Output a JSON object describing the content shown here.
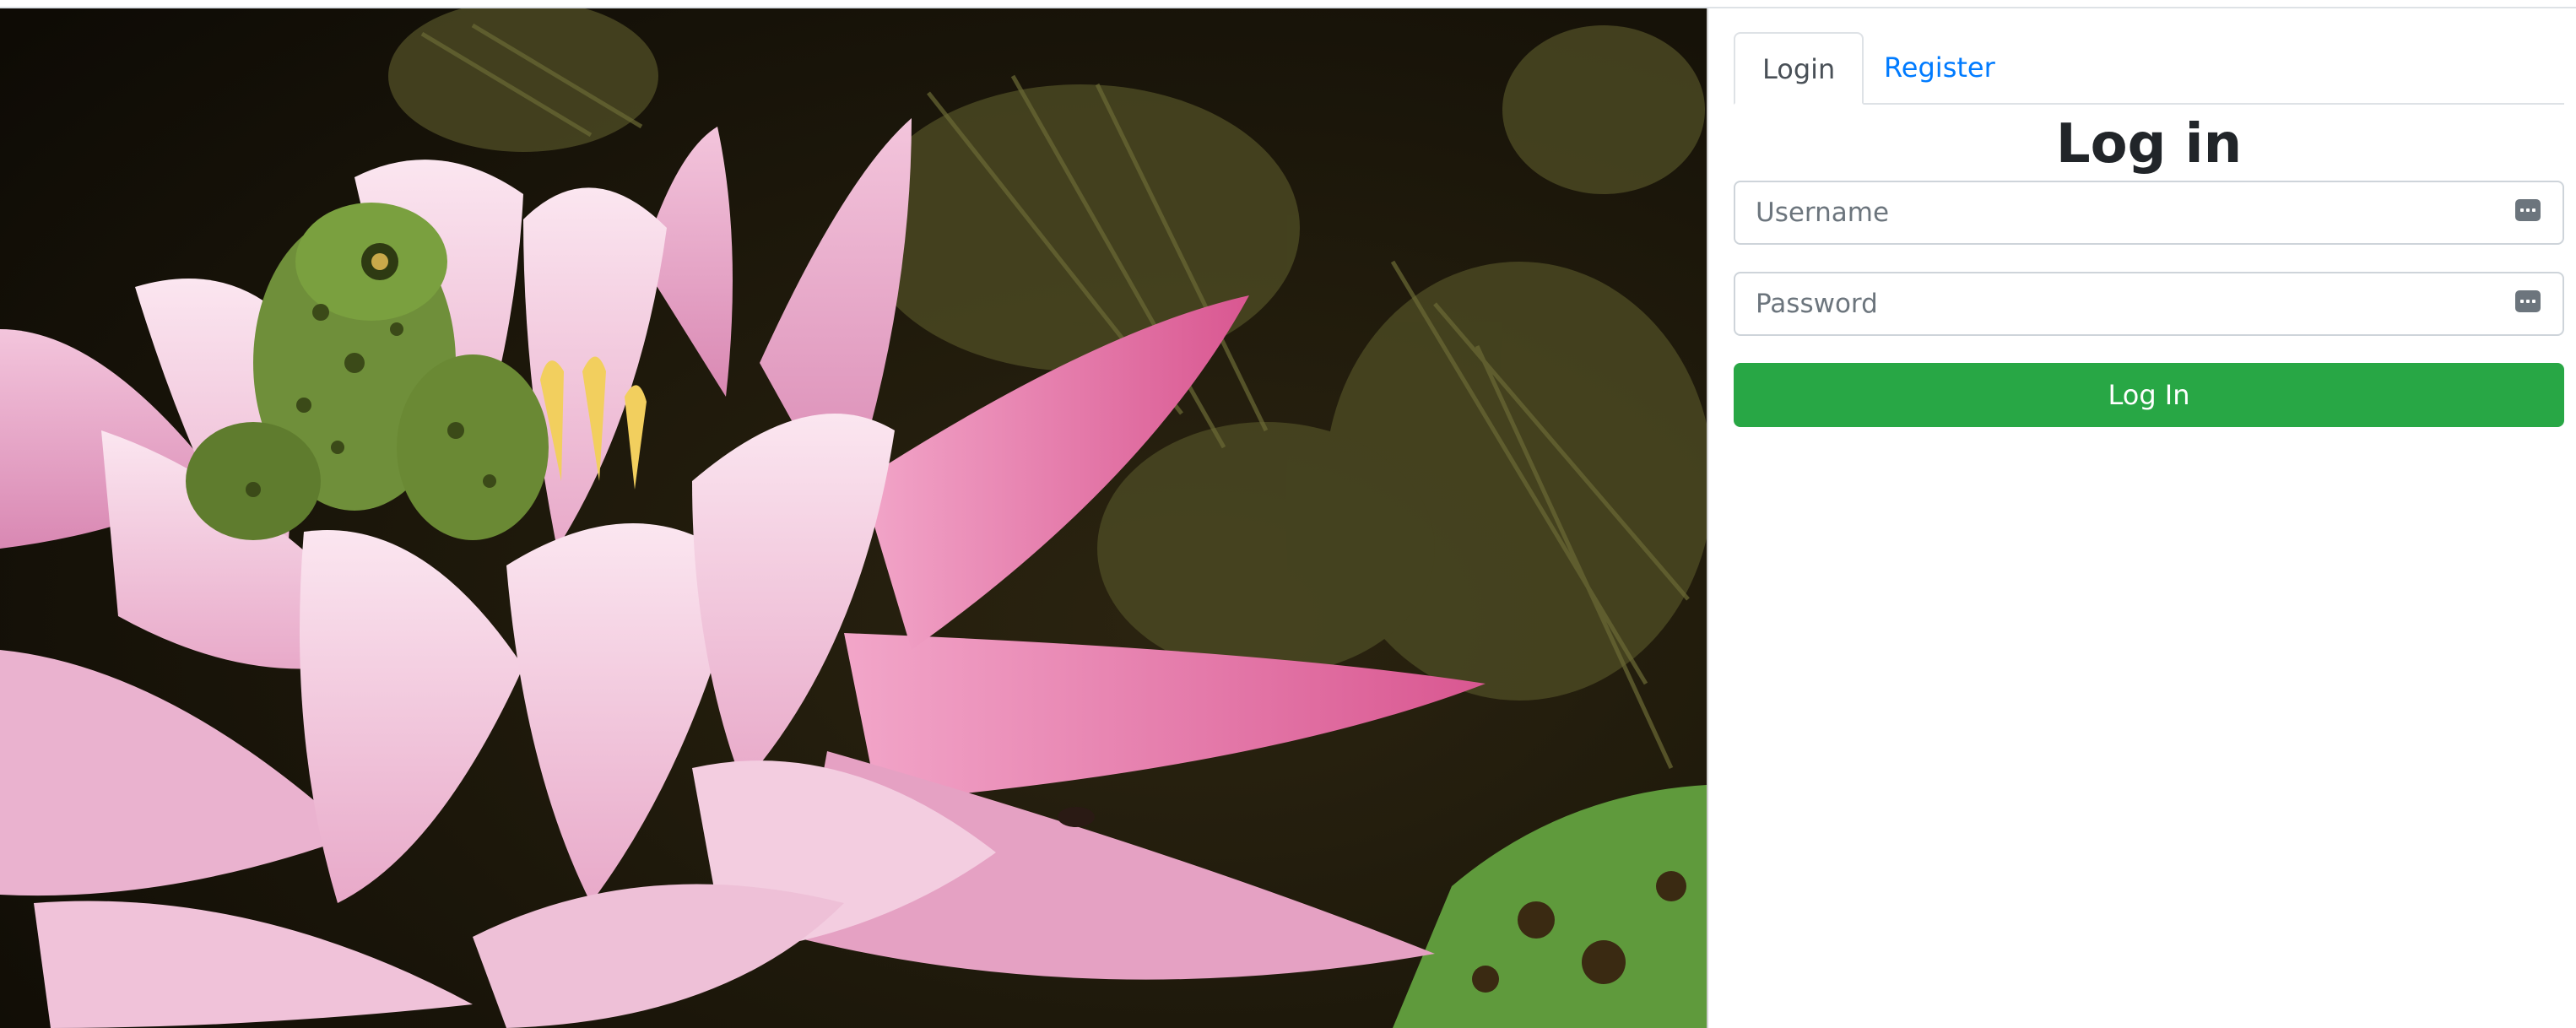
{
  "tabs": [
    {
      "label": "Login",
      "active": true
    },
    {
      "label": "Register",
      "active": false
    }
  ],
  "form": {
    "title": "Log in",
    "username_placeholder": "Username",
    "password_placeholder": "Password",
    "submit_label": "Log In"
  },
  "hero": {
    "subject": "pink water lily with a green frog",
    "colors": {
      "petal": "#e9a6c8",
      "petal_light": "#f6d3e6",
      "frog": "#6f8f3a",
      "water": "#1a1408",
      "weed": "#4b4a26",
      "pad": "#5f9a3c"
    }
  },
  "colors": {
    "accent_link": "#007bff",
    "submit": "#28a745",
    "border": "#ced4da"
  }
}
